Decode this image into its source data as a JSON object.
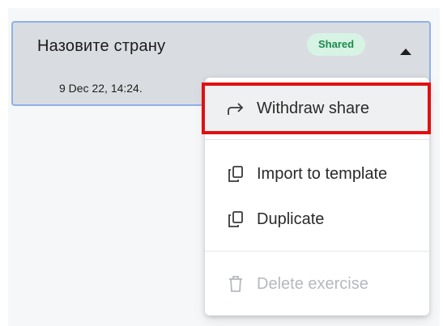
{
  "card": {
    "title": "Назовите страну",
    "date": "9 Dec 22, 14:24.",
    "badge": "Shared",
    "caret_icon": "caret-up-icon"
  },
  "menu": {
    "items": [
      {
        "label": "Withdraw share",
        "icon": "share-arrow-icon",
        "state": "highlighted"
      },
      {
        "label": "Import to template",
        "icon": "copy-icon",
        "state": "enabled"
      },
      {
        "label": "Duplicate",
        "icon": "copy-icon",
        "state": "enabled"
      },
      {
        "label": "Delete exercise",
        "icon": "trash-icon",
        "state": "disabled"
      }
    ]
  },
  "colors": {
    "card_bg": "#d9dde2",
    "card_border": "#8fb1e8",
    "badge_bg": "#d6f3e4",
    "badge_text": "#1b8a4d",
    "highlight_frame": "#e01010",
    "disabled_text": "#b5b9be"
  }
}
